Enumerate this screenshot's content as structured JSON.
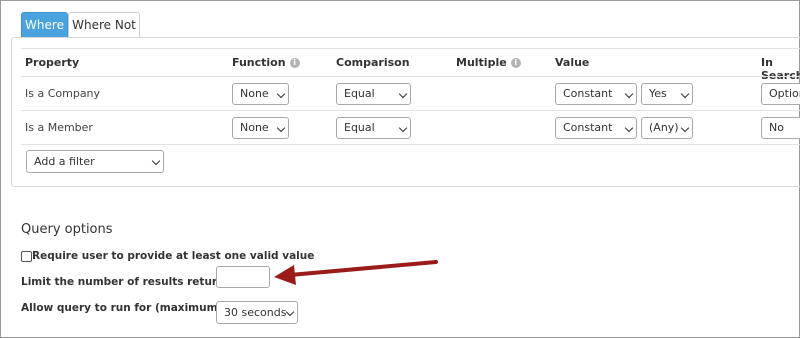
{
  "tabs": [
    {
      "label": "Where",
      "active": true
    },
    {
      "label": "Where Not",
      "active": false
    }
  ],
  "table": {
    "headers": {
      "property": "Property",
      "function": "Function",
      "comparison": "Comparison",
      "multiple": "Multiple",
      "value": "Value",
      "in_search": "In Search"
    },
    "rows": [
      {
        "property": "Is a Company",
        "function": "None",
        "comparison": "Equal",
        "value_type": "Constant",
        "value": "Yes",
        "in_search": "Optional"
      },
      {
        "property": "Is a Member",
        "function": "None",
        "comparison": "Equal",
        "value_type": "Constant",
        "value": "(Any)",
        "in_search": "No"
      }
    ],
    "add_filter": "Add a filter"
  },
  "query_options": {
    "title": "Query options",
    "require_label": "Require user to provide at least one valid value",
    "require_checked": false,
    "limit_label": "Limit the number of results returned",
    "limit_value": "",
    "allow_label": "Allow query to run for (maximum)",
    "allow_value": "30 seconds"
  },
  "colors": {
    "tab_active": "#4aa3df",
    "annotation_arrow": "#9b1b1b"
  }
}
